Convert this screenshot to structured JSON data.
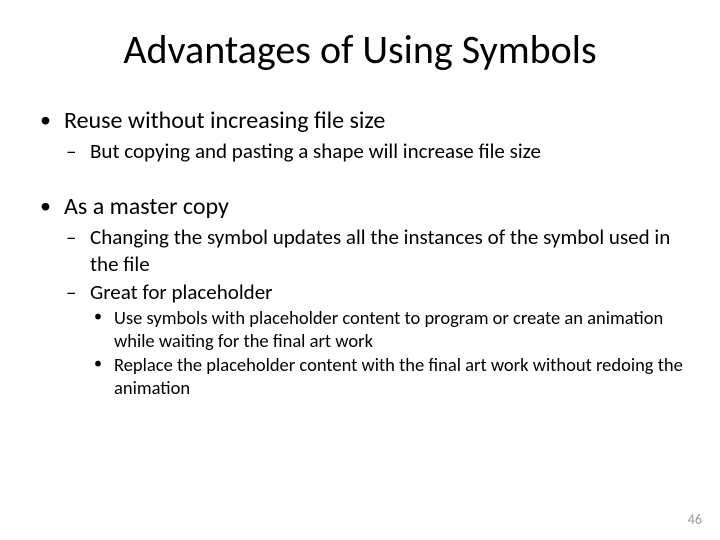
{
  "title": "Advantages of Using Symbols",
  "b1": {
    "text": "Reuse without increasing file size",
    "sub1": "But copying and pasting a shape will increase file size"
  },
  "b2": {
    "text": "As a master copy",
    "sub1": "Changing the symbol updates all the instances of the symbol used in the file",
    "sub2": "Great for placeholder",
    "sub2_1": "Use symbols with placeholder content to program or create an animation while waiting for the final art work",
    "sub2_2": "Replace the placeholder content with the final art work without redoing the animation"
  },
  "page_number": "46"
}
